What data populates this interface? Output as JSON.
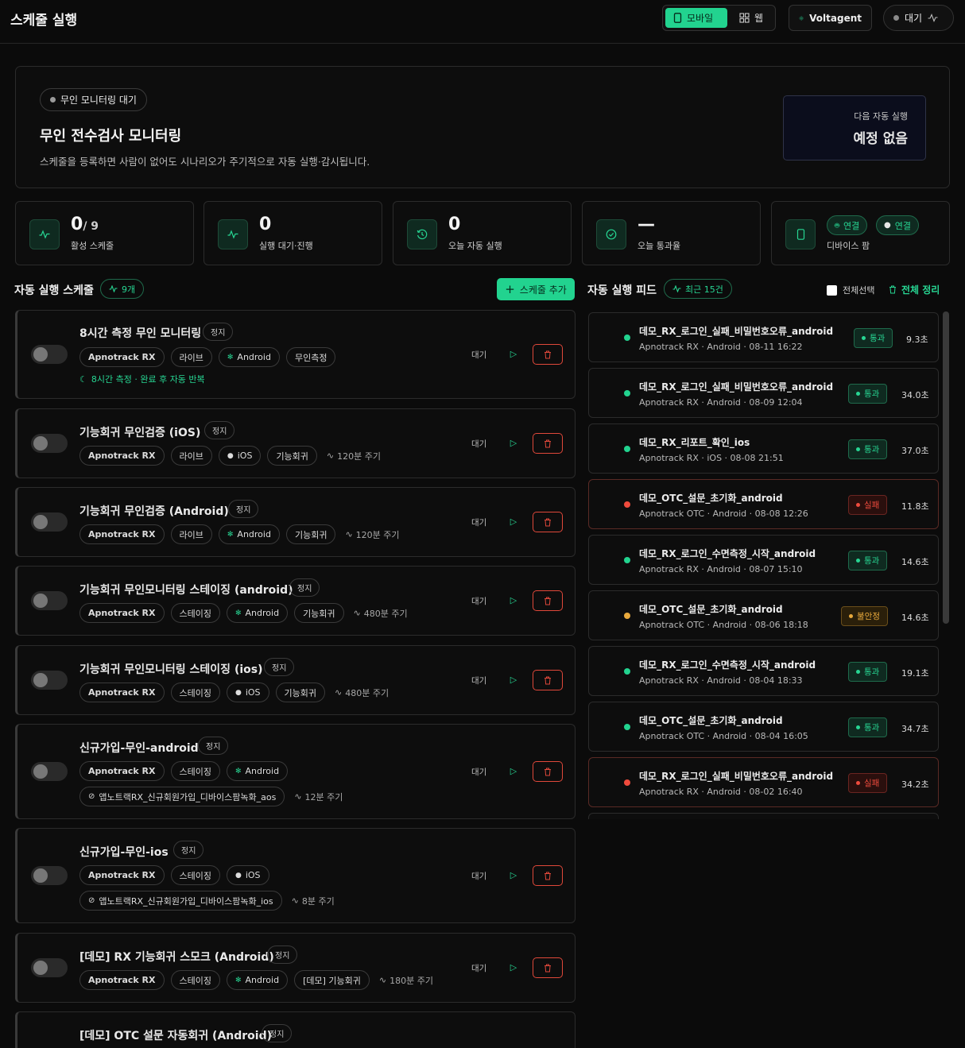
{
  "header": {
    "title": "스케줄 실행",
    "mode_mobile": "모바일",
    "mode_web": "웹",
    "app_name": "Voltagent",
    "status": "대기"
  },
  "hero": {
    "badge": "무인 모니터링 대기",
    "title": "무인 전수검사 모니터링",
    "desc": "스케줄을 등록하면 사람이 없어도 시나리오가 주기적으로 자동 실행·감시됩니다.",
    "next_label": "다음 자동 실행",
    "next_value": "예정 없음"
  },
  "stats": {
    "active": {
      "value": "0",
      "total": "/ 9",
      "label": "활성 스케줄"
    },
    "queue": {
      "value": "0",
      "label": "실행 대기·진행"
    },
    "today": {
      "value": "0",
      "label": "오늘 자동 실행"
    },
    "rate": {
      "value": "—",
      "label": "오늘 통과율"
    },
    "device": {
      "android_label": "연결",
      "ios_label": "연결",
      "label": "디바이스 팜"
    }
  },
  "schedules_section": {
    "title": "자동 실행 스케줄",
    "count": "9개",
    "add_label": "스케줄 추가"
  },
  "schedules": [
    {
      "title": "8시간 측정 무인 모니터링",
      "status": "정지",
      "tags": [
        "Apnotrack RX",
        "라이브",
        "Android",
        "무인측정"
      ],
      "repeat": "8시간 측정 · 완료 후 자동 반복",
      "state": "대기"
    },
    {
      "title": "기능회귀 무인검증 (iOS)",
      "status": "정지",
      "tags": [
        "Apnotrack RX",
        "라이브",
        "iOS",
        "기능회귀"
      ],
      "period": "120분 주기",
      "state": "대기"
    },
    {
      "title": "기능회귀 무인검증 (Android)",
      "status": "정지",
      "tags": [
        "Apnotrack RX",
        "라이브",
        "Android",
        "기능회귀"
      ],
      "period": "120분 주기",
      "state": "대기"
    },
    {
      "title": "기능회귀 무인모니터링 스테이징 (android)",
      "status": "정지",
      "tags": [
        "Apnotrack RX",
        "스테이징",
        "Android",
        "기능회귀"
      ],
      "period": "480분 주기",
      "state": "대기"
    },
    {
      "title": "기능회귀 무인모니터링 스테이징 (ios)",
      "status": "정지",
      "tags": [
        "Apnotrack RX",
        "스테이징",
        "iOS",
        "기능회귀"
      ],
      "period": "480분 주기",
      "state": "대기"
    },
    {
      "title": "신규가입-무인-android",
      "status": "정지",
      "tags": [
        "Apnotrack RX",
        "스테이징",
        "Android"
      ],
      "scenario": "앱노트랙RX_신규회원가입_디바이스팜녹화_aos",
      "period": "12분 주기",
      "state": "대기"
    },
    {
      "title": "신규가입-무인-ios",
      "status": "정지",
      "tags": [
        "Apnotrack RX",
        "스테이징",
        "iOS"
      ],
      "scenario": "앱노트랙RX_신규회원가입_디바이스팜녹화_ios",
      "period": "8분 주기",
      "state": "대기"
    },
    {
      "title": "[데모] RX 기능회귀 스모크 (Android)",
      "status": "정지",
      "tags": [
        "Apnotrack RX",
        "스테이징",
        "Android",
        "[데모] 기능회귀"
      ],
      "period": "180분 주기",
      "state": "대기"
    },
    {
      "title": "[데모] OTC 설문 자동회귀 (Android)",
      "status": "정지"
    }
  ],
  "feed_section": {
    "title": "자동 실행 피드",
    "recent": "최근 15건",
    "select_all": "전체선택",
    "clear_all": "전체 정리"
  },
  "feed": [
    {
      "name": "데모_RX_로그인_실패_비밀번호오류_android",
      "meta": "Apnotrack RX · Android · 08-11 16:22",
      "result": "통과",
      "kind": "pass",
      "duration": "9.3초"
    },
    {
      "name": "데모_RX_로그인_실패_비밀번호오류_android",
      "meta": "Apnotrack RX · Android · 08-09 12:04",
      "result": "통과",
      "kind": "pass",
      "duration": "34.0초"
    },
    {
      "name": "데모_RX_리포트_확인_ios",
      "meta": "Apnotrack RX · iOS · 08-08 21:51",
      "result": "통과",
      "kind": "pass",
      "duration": "37.0초"
    },
    {
      "name": "데모_OTC_설문_초기화_android",
      "meta": "Apnotrack OTC · Android · 08-08 12:26",
      "result": "실패",
      "kind": "fail",
      "duration": "11.8초"
    },
    {
      "name": "데모_RX_로그인_수면측정_시작_android",
      "meta": "Apnotrack RX · Android · 08-07 15:10",
      "result": "통과",
      "kind": "pass",
      "duration": "14.6초"
    },
    {
      "name": "데모_OTC_설문_초기화_android",
      "meta": "Apnotrack OTC · Android · 08-06 18:18",
      "result": "불안정",
      "kind": "warn",
      "duration": "14.6초"
    },
    {
      "name": "데모_RX_로그인_수면측정_시작_android",
      "meta": "Apnotrack RX · Android · 08-04 18:33",
      "result": "통과",
      "kind": "pass",
      "duration": "19.1초"
    },
    {
      "name": "데모_OTC_설문_초기화_android",
      "meta": "Apnotrack OTC · Android · 08-04 16:05",
      "result": "통과",
      "kind": "pass",
      "duration": "34.7초"
    },
    {
      "name": "데모_RX_로그인_실패_비밀번호오류_android",
      "meta": "Apnotrack RX · Android · 08-02 16:40",
      "result": "실패",
      "kind": "fail",
      "duration": "34.2초"
    }
  ],
  "colors": {
    "accent": "#22d38f",
    "fail": "#ef4b3d",
    "warn": "#e8a93c"
  }
}
